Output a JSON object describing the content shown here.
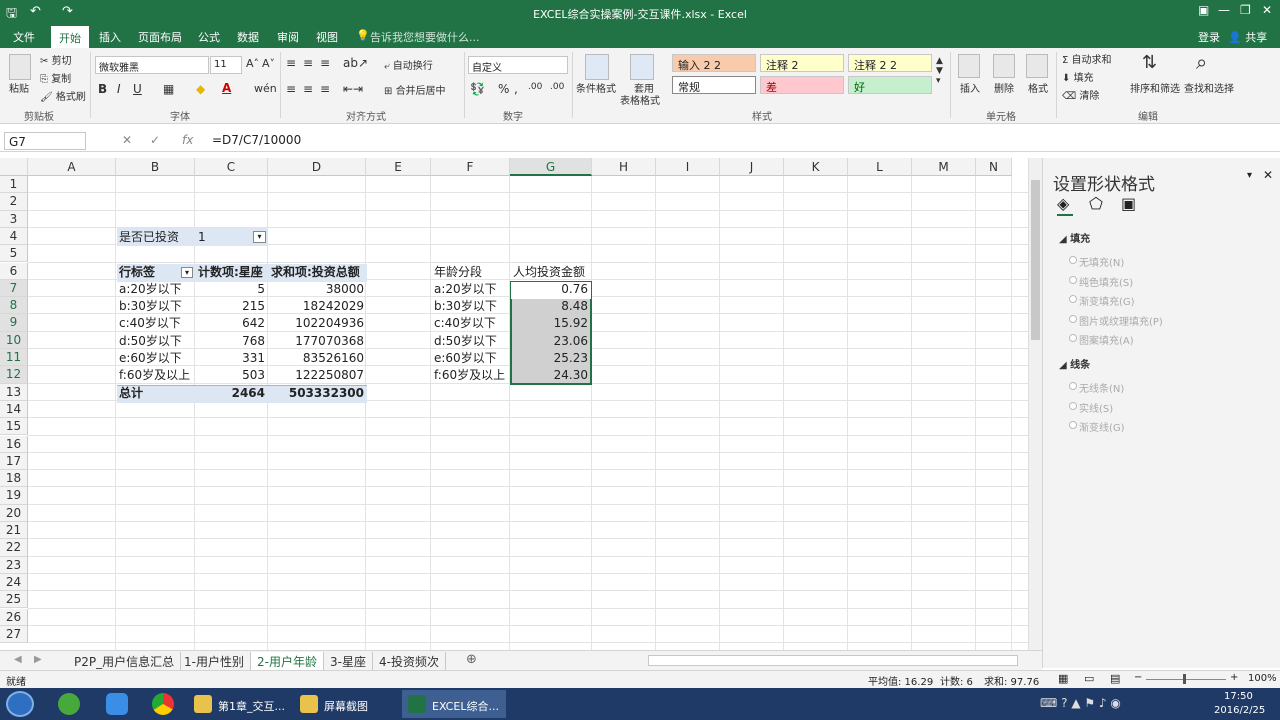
{
  "window": {
    "title": "EXCEL综合实操案例-交互课件.xlsx - Excel",
    "login": "登录",
    "share": "共享"
  },
  "ribbon_tabs": [
    "文件",
    "开始",
    "插入",
    "页面布局",
    "公式",
    "数据",
    "审阅",
    "视图"
  ],
  "tell_me": "告诉我您想要做什么...",
  "ribbon": {
    "paste": "粘贴",
    "cut": "剪切",
    "copy": "复制",
    "format_painter": "格式刷",
    "clipboard": "剪贴板",
    "font_name": "微软雅黑",
    "font_size": "11",
    "font_group": "字体",
    "wrap": "自动换行",
    "merge": "合并后居中",
    "align_group": "对齐方式",
    "number_format": "自定义",
    "number_group": "数字",
    "cond_format": "条件格式",
    "table_format_1": "套用",
    "table_format_2": "表格格式",
    "styles": [
      "输入 2 2",
      "注释 2",
      "注释 2 2",
      "常规",
      "差",
      "好"
    ],
    "styles_group": "样式",
    "insert": "插入",
    "delete": "删除",
    "format": "格式",
    "cells_group": "单元格",
    "autosum": "自动求和",
    "fill": "填充",
    "clear": "清除",
    "sort": "排序和筛选",
    "find": "查找和选择",
    "edit_group": "编辑"
  },
  "formula_bar": {
    "name_box": "G7",
    "formula": "=D7/C7/10000",
    "fx": "fx"
  },
  "columns": [
    "A",
    "B",
    "C",
    "D",
    "E",
    "F",
    "G",
    "H",
    "I",
    "J",
    "K",
    "L",
    "M",
    "N"
  ],
  "rows": [
    "1",
    "2",
    "3",
    "4",
    "5",
    "6",
    "7",
    "8",
    "9",
    "10",
    "11",
    "12",
    "13",
    "14",
    "15",
    "16",
    "17",
    "18",
    "19",
    "20",
    "21",
    "22",
    "23",
    "24",
    "25",
    "26",
    "27"
  ],
  "filter": {
    "label": "是否已投资",
    "value": "1"
  },
  "pivot": {
    "headers": [
      "行标签",
      "计数项:星座",
      "求和项:投资总额"
    ],
    "rows": [
      [
        "a:20岁以下",
        "5",
        "38000"
      ],
      [
        "b:30岁以下",
        "215",
        "18242029"
      ],
      [
        "c:40岁以下",
        "642",
        "102204936"
      ],
      [
        "d:50岁以下",
        "768",
        "177070368"
      ],
      [
        "e:60岁以下",
        "331",
        "83526160"
      ],
      [
        "f:60岁及以上",
        "503",
        "122250807"
      ]
    ],
    "total": [
      "总计",
      "2464",
      "503332300"
    ]
  },
  "calc": {
    "headers": [
      "年龄分段",
      "人均投资金额"
    ],
    "rows": [
      [
        "a:20岁以下",
        "0.76"
      ],
      [
        "b:30岁以下",
        "8.48"
      ],
      [
        "c:40岁以下",
        "15.92"
      ],
      [
        "d:50岁以下",
        "23.06"
      ],
      [
        "e:60岁以下",
        "25.23"
      ],
      [
        "f:60岁及以上",
        "24.30"
      ]
    ]
  },
  "pane": {
    "title": "设置形状格式",
    "fill_section": "填充",
    "fill_options": [
      "无填充(N)",
      "纯色填充(S)",
      "渐变填充(G)",
      "图片或纹理填充(P)",
      "图案填充(A)"
    ],
    "line_section": "线条",
    "line_options": [
      "无线条(N)",
      "实线(S)",
      "渐变线(G)"
    ]
  },
  "sheet_tabs": [
    "P2P_用户信息汇总",
    "1-用户性别",
    "2-用户年龄",
    "3-星座",
    "4-投资频次"
  ],
  "status": {
    "ready": "就绪",
    "average": "平均值: 16.29",
    "count": "计数: 6",
    "sum": "求和: 97.76",
    "zoom": "100%"
  },
  "taskbar": {
    "items": [
      "第1章_交互...",
      "屏幕截图",
      "EXCEL综合..."
    ],
    "time": "17:50",
    "date": "2016/2/25"
  }
}
